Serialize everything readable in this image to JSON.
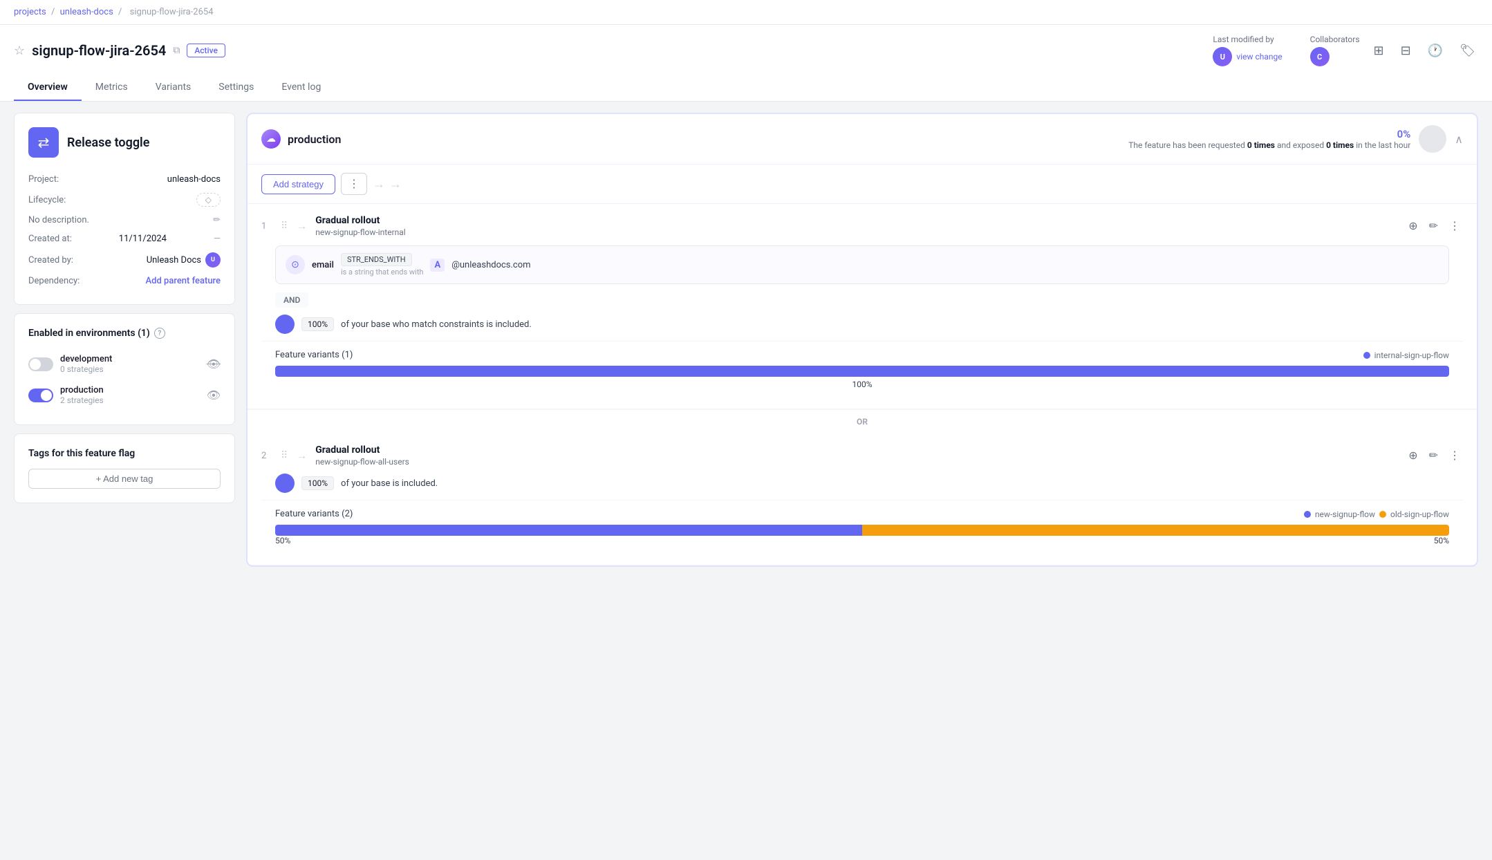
{
  "breadcrumb": {
    "projects": "projects",
    "unleash_docs": "unleash-docs",
    "separator": "/",
    "current": "signup-flow-jira-2654"
  },
  "header": {
    "title": "signup-flow-jira-2654",
    "status": "Active",
    "last_modified_label": "Last modified by",
    "view_change_link": "view change",
    "collaborators_label": "Collaborators"
  },
  "tabs": [
    {
      "label": "Overview",
      "active": true
    },
    {
      "label": "Metrics",
      "active": false
    },
    {
      "label": "Variants",
      "active": false
    },
    {
      "label": "Settings",
      "active": false
    },
    {
      "label": "Event log",
      "active": false
    }
  ],
  "sidebar": {
    "toggle_type": "Release toggle",
    "project_label": "Project:",
    "project_value": "unleash-docs",
    "lifecycle_label": "Lifecycle:",
    "no_description": "No description.",
    "created_at_label": "Created at:",
    "created_at_value": "11/11/2024",
    "created_by_label": "Created by:",
    "created_by_value": "Unleash Docs",
    "dependency_label": "Dependency:",
    "add_parent": "Add parent feature",
    "environments_title": "Enabled in environments (1)",
    "envs": [
      {
        "name": "development",
        "strategies": "0 strategies",
        "enabled": false
      },
      {
        "name": "production",
        "strategies": "2 strategies",
        "enabled": true
      }
    ],
    "tags_title": "Tags for this feature flag",
    "add_tag_label": "+ Add new tag"
  },
  "production_panel": {
    "env_name": "production",
    "percent": "0%",
    "request_text_pre": "The feature has been requested ",
    "request_times": "0 times",
    "request_text_mid": " and exposed ",
    "exposed_times": "0 times",
    "request_text_post": " in the last hour",
    "add_strategy_label": "Add strategy",
    "strategies": [
      {
        "num": "1",
        "name": "Gradual rollout",
        "sub": "new-signup-flow-internal",
        "constraint": {
          "field": "email",
          "op": "STR_ENDS_WITH",
          "op_sub": "is a string that ends with",
          "value": "@unleashdocs.com"
        },
        "rollout_pct": "100%",
        "rollout_text": "of your base who match constraints is included.",
        "variants_label": "Feature variants (1)",
        "variant_legend": [
          {
            "name": "internal-sign-up-flow",
            "color": "#6366f1"
          }
        ],
        "bar_pct": "100%",
        "bar_label_center": "100%"
      },
      {
        "num": "2",
        "name": "Gradual rollout",
        "sub": "new-signup-flow-all-users",
        "rollout_pct": "100%",
        "rollout_text": "of your base is included.",
        "variants_label": "Feature variants (2)",
        "variant_legend": [
          {
            "name": "new-signup-flow",
            "color": "#6366f1"
          },
          {
            "name": "old-sign-up-flow",
            "color": "#f59e0b"
          }
        ],
        "bar_labels": [
          "50%",
          "50%"
        ]
      }
    ]
  }
}
